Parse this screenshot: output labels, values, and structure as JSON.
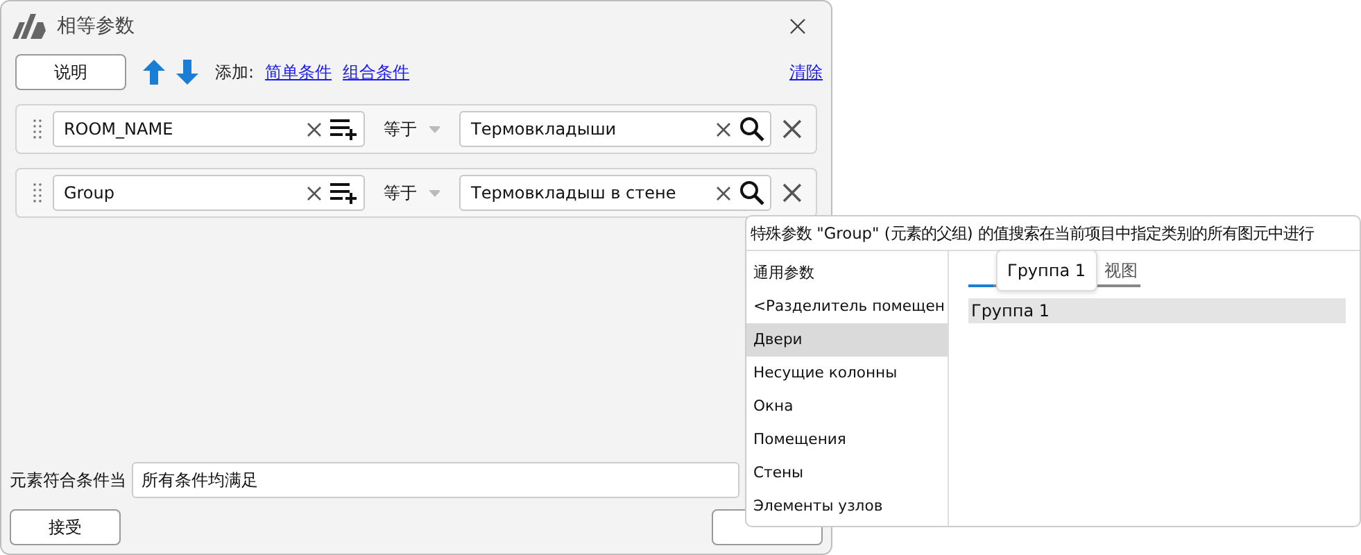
{
  "window": {
    "title": "相等参数"
  },
  "toolbar": {
    "help_button": "说明",
    "add_label": "添加:",
    "add_links": [
      "简单条件",
      "组合条件"
    ],
    "clear_link": "清除"
  },
  "conditions": [
    {
      "parameter": "ROOM_NAME",
      "operator": "等于",
      "value": "Термовкладыши"
    },
    {
      "parameter": "Group",
      "operator": "等于",
      "value": "Термовкладыш в стене"
    }
  ],
  "match": {
    "label": "元素符合条件当",
    "value": "所有条件均满足"
  },
  "buttons": {
    "accept": "接受"
  },
  "popup": {
    "hint": "特殊参数 \"Group\" (元素的父组) 的值搜索在当前项目中指定类别的所有图元中进行",
    "categories": [
      {
        "label": "通用参数",
        "selected": false
      },
      {
        "label": "<Разделитель помещен",
        "selected": false
      },
      {
        "label": "Двери",
        "selected": true
      },
      {
        "label": "Несущие колонны",
        "selected": false
      },
      {
        "label": "Окна",
        "selected": false
      },
      {
        "label": "Помещения",
        "selected": false
      },
      {
        "label": "Стены",
        "selected": false
      },
      {
        "label": "Элементы узлов",
        "selected": false
      }
    ],
    "tabs": [
      {
        "selected": true
      },
      {
        "label": "视图",
        "selected": false
      }
    ],
    "values": [
      {
        "label": "Группа 1",
        "selected": true
      }
    ],
    "tooltip": "Группа 1"
  }
}
